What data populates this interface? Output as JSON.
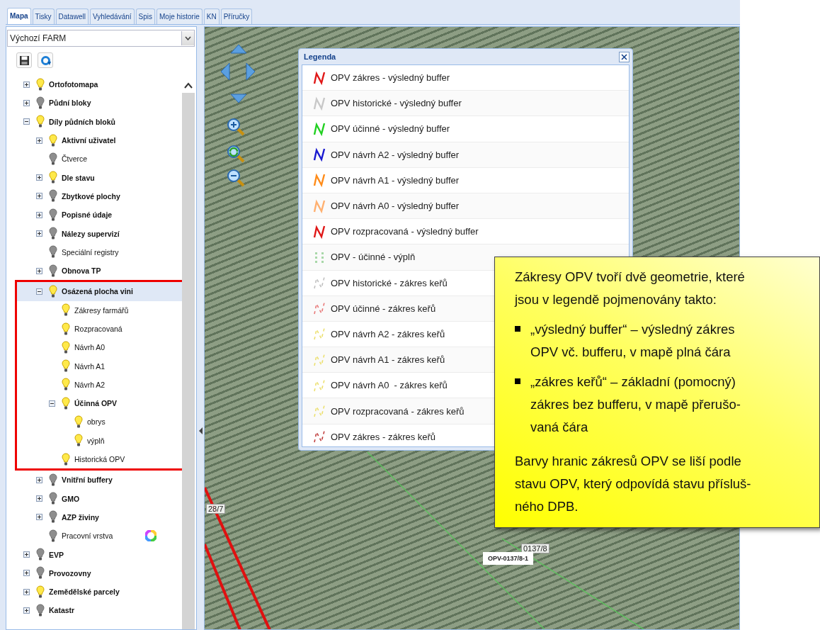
{
  "tabs": [
    {
      "label": "Mapa",
      "selected": true
    },
    {
      "label": "Tisky",
      "selected": false
    },
    {
      "label": "Datawell",
      "selected": false
    },
    {
      "label": "Vyhledávání",
      "selected": false
    },
    {
      "label": "Spis",
      "selected": false
    },
    {
      "label": "Moje historie",
      "selected": false
    },
    {
      "label": "KN",
      "selected": false
    },
    {
      "label": "Příručky",
      "selected": false
    }
  ],
  "profile_select": {
    "value": "Výchozí FARM"
  },
  "tree": [
    {
      "label": "Ortofotomapa",
      "kind": "group",
      "visible": true,
      "expanded": false,
      "selected": false
    },
    {
      "label": "Půdní bloky",
      "kind": "group",
      "visible": false,
      "expanded": false,
      "selected": false
    },
    {
      "label": "Díly půdních bloků",
      "kind": "group",
      "visible": true,
      "expanded": true,
      "selected": false,
      "children": [
        {
          "label": "Aktivní uživatel",
          "kind": "group",
          "visible": true,
          "expanded": false,
          "selected": false
        },
        {
          "label": "Čtverce",
          "kind": "layer",
          "visible": false,
          "selected": false
        },
        {
          "label": "Dle stavu",
          "kind": "group",
          "visible": true,
          "expanded": false,
          "selected": false
        },
        {
          "label": "Zbytkové plochy",
          "kind": "group",
          "visible": false,
          "expanded": false,
          "selected": false
        },
        {
          "label": "Popisné údaje",
          "kind": "group",
          "visible": false,
          "expanded": false,
          "selected": false
        },
        {
          "label": "Nálezy supervizí",
          "kind": "group",
          "visible": false,
          "expanded": false,
          "selected": false
        },
        {
          "label": "Speciální registry",
          "kind": "layer",
          "visible": false,
          "selected": false
        },
        {
          "label": "Obnova TP",
          "kind": "group",
          "visible": false,
          "expanded": false,
          "selected": false
        },
        {
          "label": "Osázená plocha vini",
          "kind": "group",
          "visible": true,
          "expanded": true,
          "selected": true,
          "outlined": true,
          "children": [
            {
              "label": "Zákresy farmářů",
              "kind": "layer",
              "visible": true,
              "selected": false
            },
            {
              "label": "Rozpracovaná",
              "kind": "layer",
              "visible": true,
              "selected": false
            },
            {
              "label": "Návrh A0",
              "kind": "layer",
              "visible": true,
              "selected": false
            },
            {
              "label": "Návrh A1",
              "kind": "layer",
              "visible": true,
              "selected": false
            },
            {
              "label": "Návrh A2",
              "kind": "layer",
              "visible": true,
              "selected": false
            },
            {
              "label": "Účinná OPV",
              "kind": "group",
              "visible": true,
              "expanded": true,
              "selected": false,
              "children": [
                {
                  "label": "obrys",
                  "kind": "layer",
                  "visible": true,
                  "selected": false
                },
                {
                  "label": "výplň",
                  "kind": "layer",
                  "visible": true,
                  "selected": false
                }
              ]
            },
            {
              "label": "Historická OPV",
              "kind": "layer",
              "visible": true,
              "selected": false
            }
          ]
        },
        {
          "label": "Vnitřní buffery",
          "kind": "group",
          "visible": false,
          "expanded": false,
          "selected": false
        },
        {
          "label": "GMO",
          "kind": "group",
          "visible": false,
          "expanded": false,
          "selected": false
        },
        {
          "label": "AZP živiny",
          "kind": "group",
          "visible": false,
          "expanded": false,
          "selected": false
        },
        {
          "label": "Pracovní vrstva",
          "kind": "layer",
          "visible": false,
          "selected": false,
          "style_icon": true
        }
      ]
    },
    {
      "label": "EVP",
      "kind": "group",
      "visible": false,
      "expanded": false,
      "selected": false
    },
    {
      "label": "Provozovny",
      "kind": "group",
      "visible": false,
      "expanded": false,
      "selected": false
    },
    {
      "label": "Zemědělské parcely",
      "kind": "group",
      "visible": true,
      "expanded": false,
      "selected": false
    },
    {
      "label": "Katastr",
      "kind": "group",
      "visible": false,
      "expanded": false,
      "selected": false
    }
  ],
  "map": {
    "labels": [
      {
        "text": "28/7",
        "kind": "parcel"
      },
      {
        "text": "0137/8",
        "kind": "parcel"
      },
      {
        "text": "OPV-0137/8-1",
        "kind": "opv"
      }
    ]
  },
  "legend": {
    "title": "Legenda",
    "items": [
      {
        "label": "OPV zákres - výsledný buffer",
        "kind": "solid",
        "color": "#e01818"
      },
      {
        "label": "OPV historické - výsledný buffer",
        "kind": "solid",
        "color": "#c8c8c8"
      },
      {
        "label": "OPV účinné - výsledný buffer",
        "kind": "solid",
        "color": "#22d022"
      },
      {
        "label": "OPV návrh A2 - výsledný buffer",
        "kind": "solid",
        "color": "#1a1ad0"
      },
      {
        "label": "OPV návrh A1 - výsledný buffer",
        "kind": "solid",
        "color": "#ff8c1a"
      },
      {
        "label": "OPV návrh A0 - výsledný buffer",
        "kind": "solid",
        "color": "#ffb070"
      },
      {
        "label": "OPV rozpracovaná - výsledný buffer",
        "kind": "solid",
        "color": "#e01818"
      },
      {
        "label": "OPV - účinné - výplň",
        "kind": "fill",
        "color": "#a8d8a8"
      },
      {
        "label": "OPV historické - zákres keřů",
        "kind": "dashed",
        "color": "#c0c0c0"
      },
      {
        "label": "OPV účinné - zákres keřů",
        "kind": "dashed",
        "color": "#e87878"
      },
      {
        "label": "OPV návrh A2 - zákres keřů",
        "kind": "dashed",
        "color": "#ece070"
      },
      {
        "label": "OPV návrh A1 - zákres keřů",
        "kind": "dashed",
        "color": "#ece070"
      },
      {
        "label": "OPV návrh A0  - zákres keřů",
        "kind": "dashed",
        "color": "#ece070"
      },
      {
        "label": "OPV rozpracovaná - zákres keřů",
        "kind": "dashed",
        "color": "#ece070"
      },
      {
        "label": "OPV zákres - zákres keřů",
        "kind": "dashed",
        "color": "#c04040"
      }
    ]
  },
  "callout": {
    "intro": "Zákresy OPV tvoří dvě geometrie, které\njsou v legendě pojmenovány takto:",
    "bullets": [
      "„výsledný buffer“ – výsledný zákres\nOPV vč. bufferu, v mapě plná čára",
      "„zákres keřů“ – základní (pomocný)\nzákres bez bufferu, v mapě přerušo-\nvaná čára"
    ],
    "outro": "Barvy hranic zákresů OPV se liší podle\nstavu OPV, který odpovídá stavu přísluš-\nného DPB."
  }
}
